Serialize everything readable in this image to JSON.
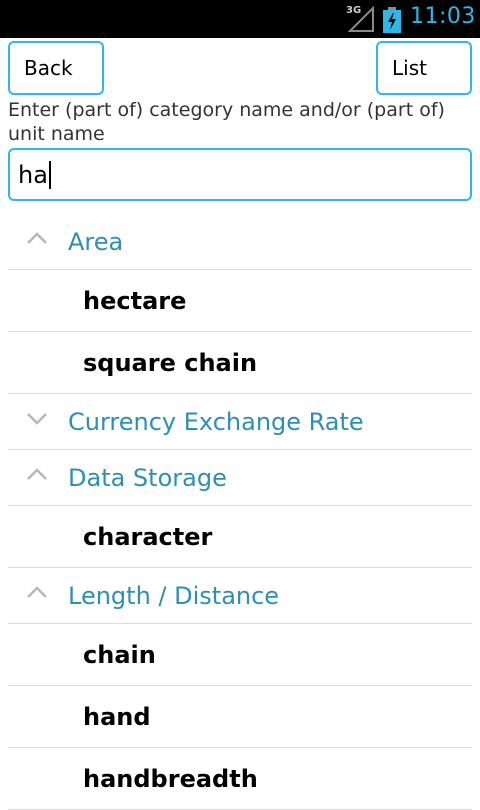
{
  "status_bar": {
    "network": "3G",
    "time": "11:03",
    "colors": {
      "accent": "#33b5e5"
    }
  },
  "toolbar": {
    "back_label": "Back",
    "list_label": "List"
  },
  "search": {
    "prompt": "Enter (part of) category name and/or (part of) unit name",
    "value": "ha"
  },
  "groups": [
    {
      "name": "Area",
      "expanded": true,
      "units": [
        "hectare",
        "square chain"
      ]
    },
    {
      "name": "Currency Exchange Rate",
      "expanded": false,
      "units": []
    },
    {
      "name": "Data Storage",
      "expanded": true,
      "units": [
        "character"
      ]
    },
    {
      "name": "Length / Distance",
      "expanded": true,
      "units": [
        "chain",
        "hand",
        "handbreadth"
      ]
    }
  ],
  "colors": {
    "accent": "#33b5e5",
    "group_text": "#2e8fb3",
    "divider": "#dcdcdc"
  }
}
